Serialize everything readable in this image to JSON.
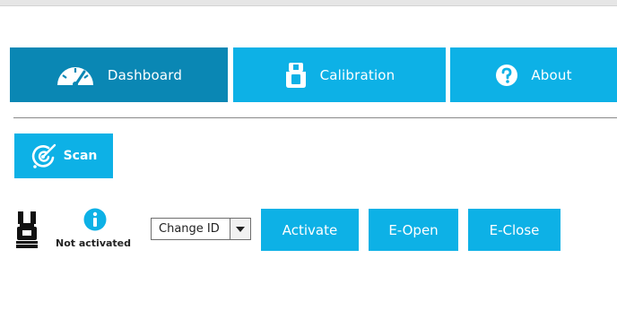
{
  "tabs": [
    {
      "label": "Dashboard",
      "icon": "speedometer-icon",
      "active": true
    },
    {
      "label": "Calibration",
      "icon": "gripper-calibration-icon",
      "active": false
    },
    {
      "label": "About",
      "icon": "question-icon",
      "active": false
    }
  ],
  "scan": {
    "label": "Scan",
    "icon": "radar-scan-icon"
  },
  "device": {
    "icon": "gripper-icon",
    "status_icon": "info-icon",
    "status": "Not activated"
  },
  "id_select": {
    "value": "Change ID",
    "icon": "dropdown-arrow-icon"
  },
  "actions": {
    "activate": "Activate",
    "e_open": "E-Open",
    "e_close": "E-Close"
  },
  "colors": {
    "accent": "#0db1e6",
    "accent_active": "#0a87b4",
    "text_on_accent": "#ffffff"
  }
}
